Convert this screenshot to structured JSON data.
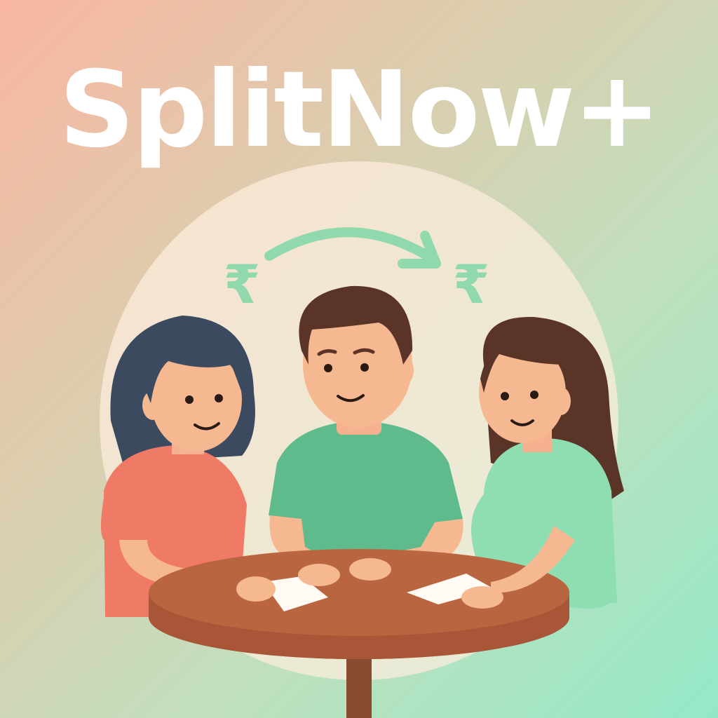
{
  "brand": {
    "name": "SplitNow+"
  },
  "illustration": {
    "currency_symbol": "₹",
    "people": [
      "woman-left",
      "man-center",
      "woman-right"
    ],
    "icons": [
      "rupee-icon",
      "transfer-arrow-icon"
    ]
  },
  "colors": {
    "background_start": "#f9b6a0",
    "background_end": "#93e8c8",
    "title_text": "#ffffff",
    "accent_green": "#8fd9ad",
    "table": "#b45d3c",
    "shirt_left": "#ef7a66",
    "shirt_center": "#5fbb8c",
    "shirt_right": "#8fdeb2"
  }
}
